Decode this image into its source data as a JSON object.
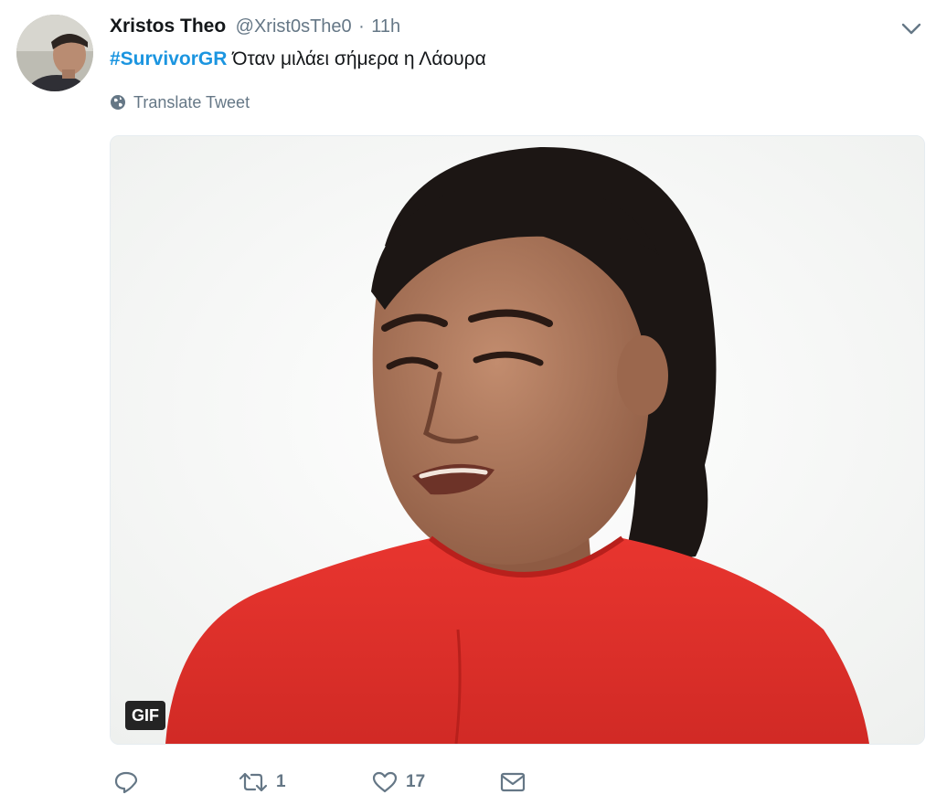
{
  "tweet": {
    "author_name": "Xristos Theo",
    "author_handle": "@Xrist0sThe0",
    "separator": "·",
    "time": "11h",
    "hashtag": "#SurvivorGR",
    "text": " Όταν μιλάει σήμερα η Λάουρα",
    "translate_label": "Translate Tweet",
    "media_badge": "GIF"
  },
  "actions": {
    "reply_count": "",
    "retweet_count": "1",
    "like_count": "17"
  },
  "colors": {
    "link": "#1b95e0",
    "muted": "#657786",
    "text": "#14171a"
  },
  "icons": {
    "menu": "chevron-down-icon",
    "translate": "globe-icon",
    "reply": "reply-icon",
    "retweet": "retweet-icon",
    "like": "heart-icon",
    "dm": "envelope-icon"
  }
}
